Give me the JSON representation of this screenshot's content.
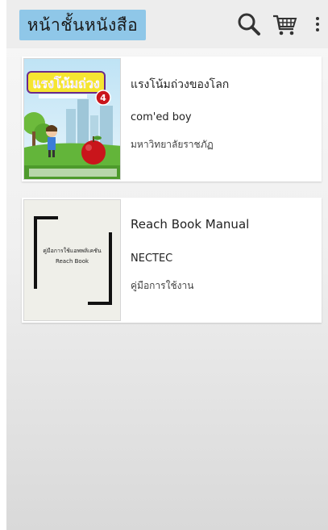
{
  "header": {
    "title": "หน้าชั้นหนังสือ",
    "icons": [
      "search-icon",
      "cart-icon",
      "more-vert-icon"
    ]
  },
  "books": [
    {
      "title": "แรงโน้มถ่วงของโลก",
      "author": "com'ed boy",
      "category": "มหาวิทยาลัยราชภัฏ",
      "cover": {
        "headline": "แรงโน้มถ่วง",
        "badge": "4"
      }
    },
    {
      "title": "Reach Book Manual",
      "author": "NECTEC",
      "category": "คู่มือการใช้งาน",
      "cover": {
        "line1": "คู่มือการใช้แอพพลิเคชัน",
        "line2": "Reach Book"
      }
    }
  ],
  "colors": {
    "title_box": "#8fc7e8",
    "app_bar": "#ededed",
    "cover_red": "#c9151b"
  }
}
